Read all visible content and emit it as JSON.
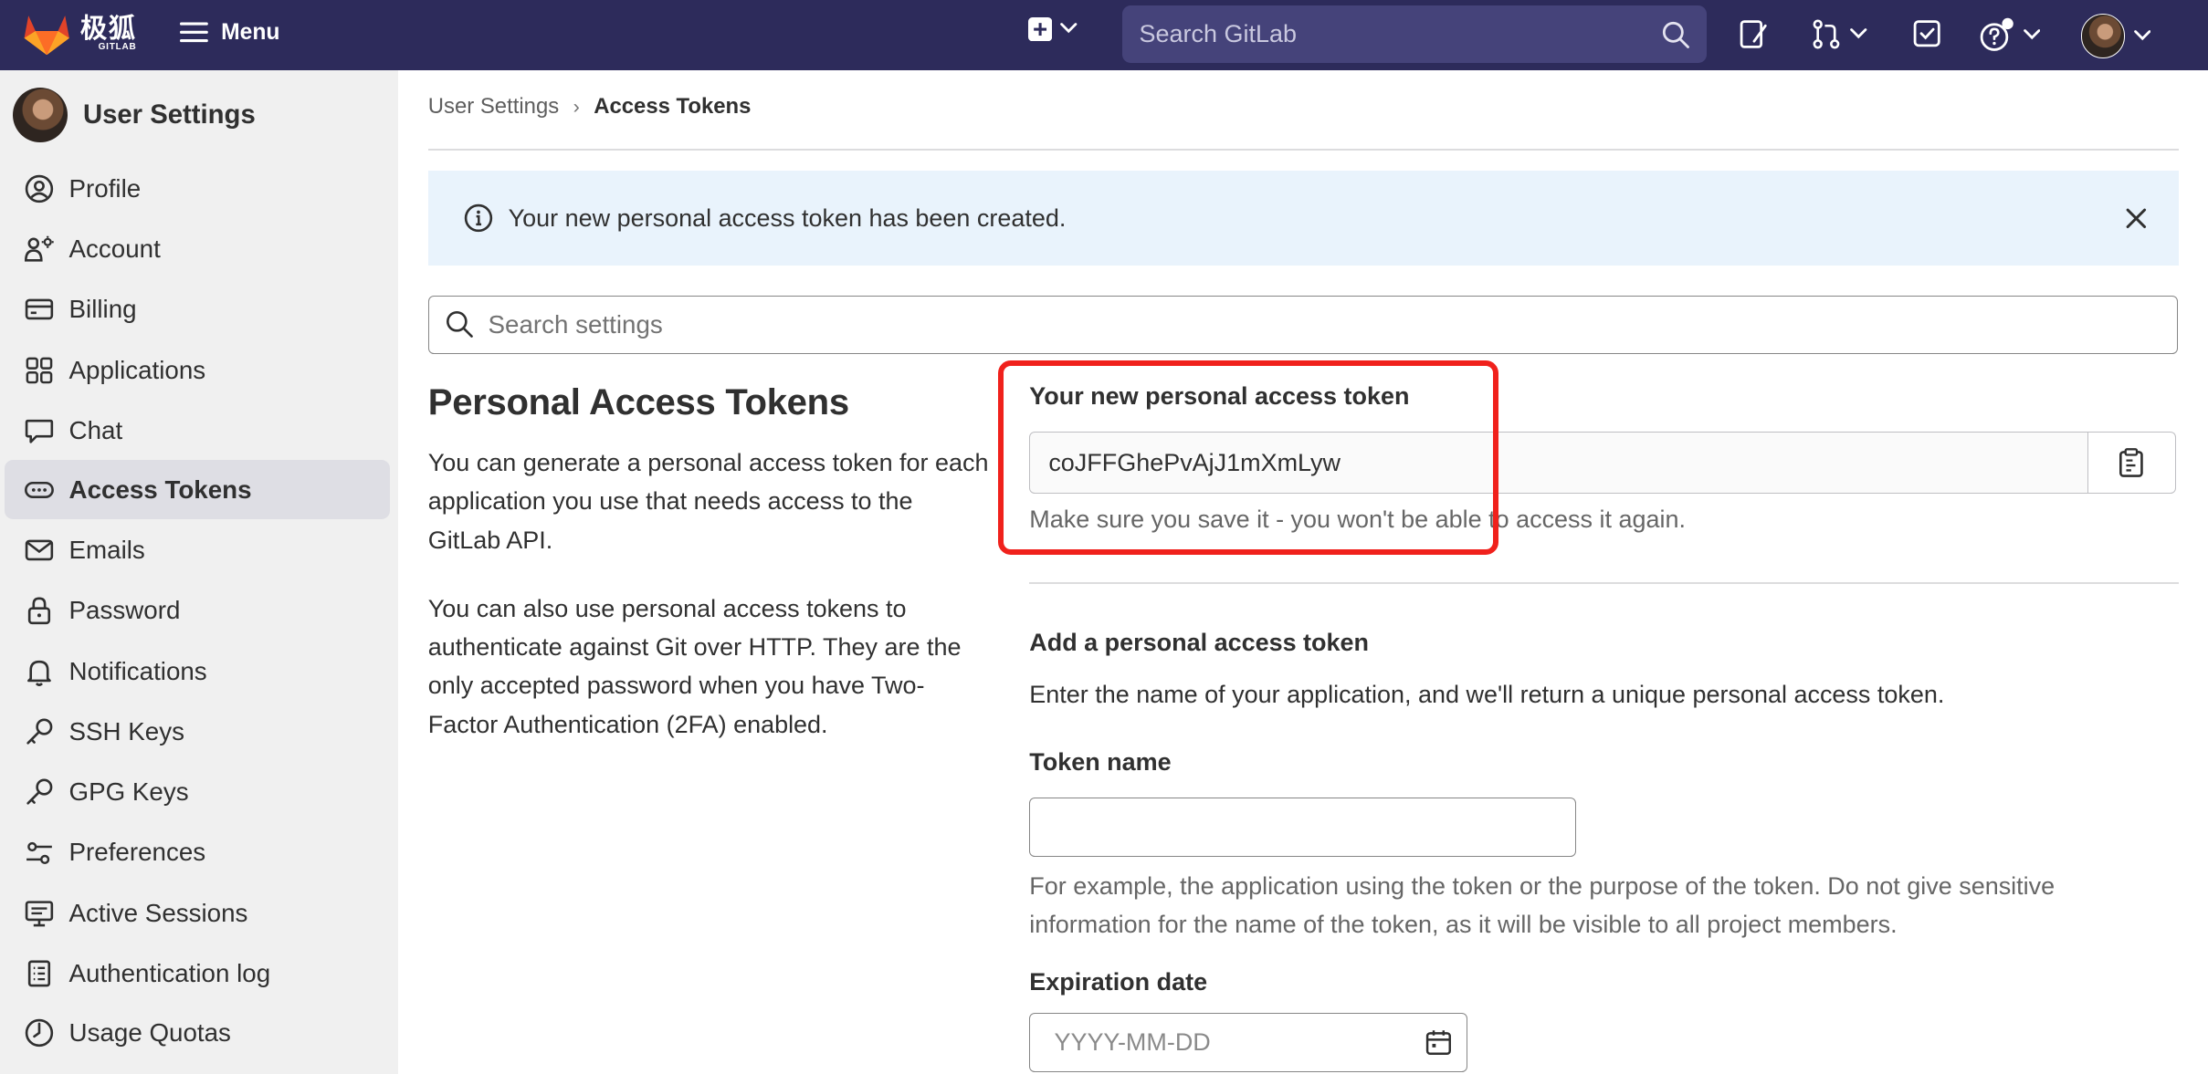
{
  "topbar": {
    "logo_cn": "极狐",
    "logo_sub": "GITLAB",
    "menu_label": "Menu",
    "search_placeholder": "Search GitLab",
    "icons": [
      "plus-square-icon",
      "chevron-down-icon",
      "search-icon",
      "issues-icon",
      "merge-request-icon",
      "todo-icon",
      "help-icon",
      "user-avatar"
    ]
  },
  "sidebar": {
    "title": "User Settings",
    "items": [
      {
        "label": "Profile",
        "icon": "profile-icon"
      },
      {
        "label": "Account",
        "icon": "account-icon"
      },
      {
        "label": "Billing",
        "icon": "billing-icon"
      },
      {
        "label": "Applications",
        "icon": "applications-icon"
      },
      {
        "label": "Chat",
        "icon": "chat-icon"
      },
      {
        "label": "Access Tokens",
        "icon": "access-tokens-icon",
        "active": true
      },
      {
        "label": "Emails",
        "icon": "emails-icon"
      },
      {
        "label": "Password",
        "icon": "password-icon"
      },
      {
        "label": "Notifications",
        "icon": "notifications-icon"
      },
      {
        "label": "SSH Keys",
        "icon": "ssh-keys-icon"
      },
      {
        "label": "GPG Keys",
        "icon": "gpg-keys-icon"
      },
      {
        "label": "Preferences",
        "icon": "preferences-icon"
      },
      {
        "label": "Active Sessions",
        "icon": "active-sessions-icon"
      },
      {
        "label": "Authentication log",
        "icon": "authentication-log-icon"
      },
      {
        "label": "Usage Quotas",
        "icon": "usage-quotas-icon"
      }
    ]
  },
  "breadcrumb": {
    "parent": "User Settings",
    "separator": "›",
    "current": "Access Tokens"
  },
  "alert": {
    "text": "Your new personal access token has been created."
  },
  "settings_search": {
    "placeholder": "Search settings"
  },
  "section": {
    "title": "Personal Access Tokens",
    "paragraph1": "You can generate a personal access token for each application you use that needs access to the GitLab API.",
    "paragraph2": "You can also use personal access tokens to authenticate against Git over HTTP. They are the only accepted password when you have Two-Factor Authentication (2FA) enabled."
  },
  "new_token": {
    "label": "Your new personal access token",
    "value": "coJFFGhePvAjJ1mXmLyw",
    "help": "Make sure you save it - you won't be able to access it again."
  },
  "add_token": {
    "title": "Add a personal access token",
    "description": "Enter the name of your application, and we'll return a unique personal access token.",
    "name_label": "Token name",
    "name_value": "",
    "name_help": "For example, the application using the token or the purpose of the token. Do not give sensitive information for the name of the token, as it will be visible to all project members.",
    "expiration_label": "Expiration date",
    "expiration_placeholder": "YYYY-MM-DD"
  },
  "colors": {
    "topbar": "#2d2b5b",
    "highlight": "#f0211c",
    "alert_bg": "#e9f3fc",
    "sidebar_bg": "#f0f0f0"
  }
}
